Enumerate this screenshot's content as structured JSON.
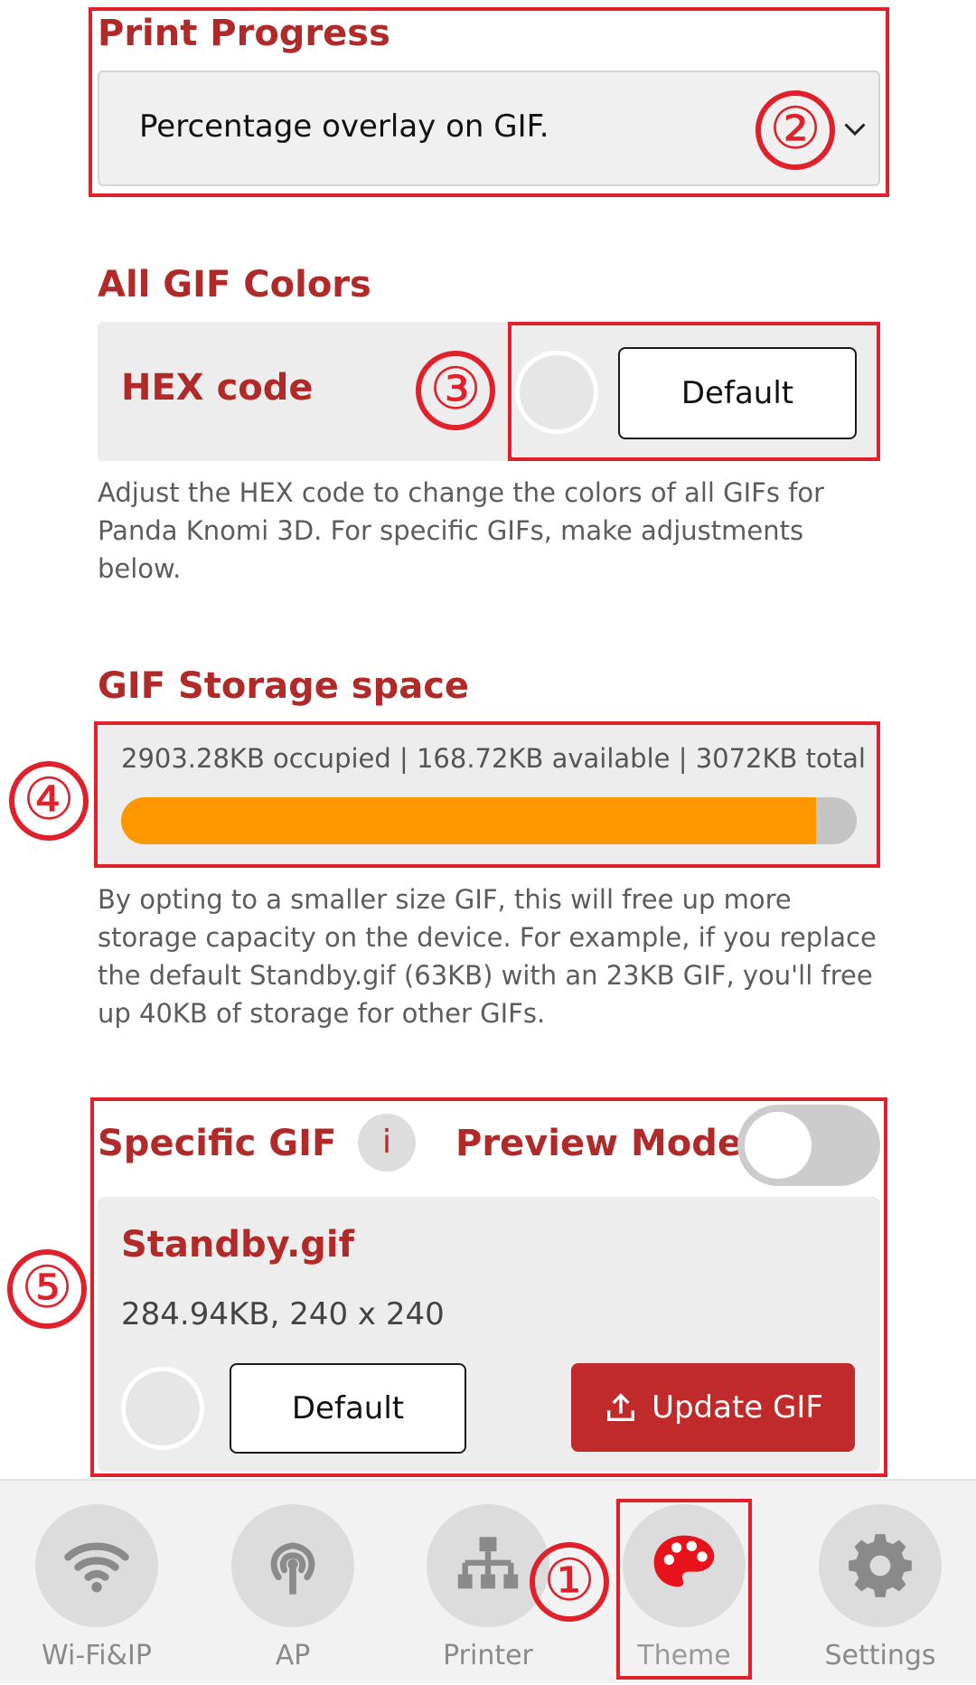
{
  "print_progress": {
    "title": "Print Progress",
    "selected": "Percentage overlay on GIF."
  },
  "gif_colors": {
    "title": "All GIF Colors",
    "hex_label": "HEX code",
    "default_button": "Default",
    "help": "Adjust the HEX code to change the colors of all GIFs for Panda Knomi 3D. For specific GIFs, make adjustments below."
  },
  "storage": {
    "title": "GIF Storage space",
    "summary": "2903.28KB occupied | 168.72KB available | 3072KB total",
    "used_fraction": 0.945,
    "help": "By opting to a smaller size GIF, this will free up more storage capacity on the device. For example, if you replace the default Standby.gif (63KB) with an 23KB GIF, you'll free up 40KB of storage for other GIFs."
  },
  "specific_gif": {
    "title": "Specific GIF",
    "info_glyph": "i",
    "preview_mode_label": "Preview Mode",
    "preview_mode_on": false,
    "card": {
      "name": "Standby.gif",
      "meta": "284.94KB, 240 x 240",
      "default_button": "Default",
      "update_button": "Update GIF"
    }
  },
  "annotations": [
    "①",
    "②",
    "③",
    "④",
    "⑤"
  ],
  "bottom_nav": [
    {
      "label": "Wi-Fi&IP",
      "icon": "wifi-icon"
    },
    {
      "label": "AP",
      "icon": "antenna-icon"
    },
    {
      "label": "Printer",
      "icon": "network-tree-icon"
    },
    {
      "label": "Theme",
      "icon": "palette-icon",
      "active": true
    },
    {
      "label": "Settings",
      "icon": "gear-icon"
    }
  ],
  "colors": {
    "accent_red": "#b02a2a",
    "annotation_red": "#e0202a",
    "progress_orange": "#ff9800",
    "primary_button": "#c02a2a"
  }
}
